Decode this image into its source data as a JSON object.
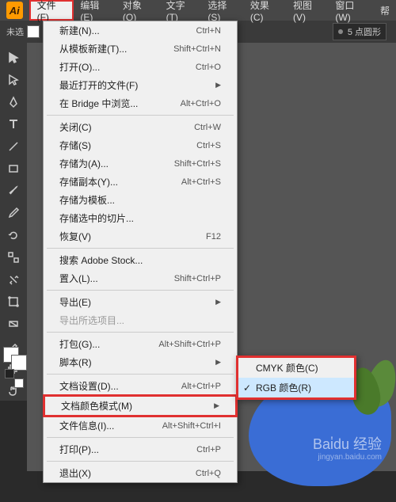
{
  "menubar": {
    "items": [
      "文件(F)",
      "编辑(E)",
      "对象(O)",
      "文字(T)",
      "选择(S)",
      "效果(C)",
      "视图(V)",
      "窗口(W)",
      "帮"
    ]
  },
  "secondbar": {
    "status": "未选",
    "prop": "5 点圆形"
  },
  "dropdown": {
    "items": [
      {
        "label": "新建(N)...",
        "shortcut": "Ctrl+N"
      },
      {
        "label": "从模板新建(T)...",
        "shortcut": "Shift+Ctrl+N"
      },
      {
        "label": "打开(O)...",
        "shortcut": "Ctrl+O"
      },
      {
        "label": "最近打开的文件(F)",
        "arrow": true
      },
      {
        "label": "在 Bridge 中浏览...",
        "shortcut": "Alt+Ctrl+O"
      },
      {
        "sep": true
      },
      {
        "label": "关闭(C)",
        "shortcut": "Ctrl+W"
      },
      {
        "label": "存储(S)",
        "shortcut": "Ctrl+S"
      },
      {
        "label": "存储为(A)...",
        "shortcut": "Shift+Ctrl+S"
      },
      {
        "label": "存储副本(Y)...",
        "shortcut": "Alt+Ctrl+S"
      },
      {
        "label": "存储为模板...",
        "shortcut": ""
      },
      {
        "label": "存储选中的切片...",
        "shortcut": ""
      },
      {
        "label": "恢复(V)",
        "shortcut": "F12"
      },
      {
        "sep": true
      },
      {
        "label": "搜索 Adobe Stock...",
        "shortcut": ""
      },
      {
        "label": "置入(L)...",
        "shortcut": "Shift+Ctrl+P"
      },
      {
        "sep": true
      },
      {
        "label": "导出(E)",
        "arrow": true
      },
      {
        "label": "导出所选项目...",
        "disabled": true
      },
      {
        "sep": true
      },
      {
        "label": "打包(G)...",
        "shortcut": "Alt+Shift+Ctrl+P"
      },
      {
        "label": "脚本(R)",
        "arrow": true
      },
      {
        "sep": true
      },
      {
        "label": "文档设置(D)...",
        "shortcut": "Alt+Ctrl+P"
      },
      {
        "label": "文档颜色模式(M)",
        "arrow": true,
        "framed": true
      },
      {
        "label": "文件信息(I)...",
        "shortcut": "Alt+Shift+Ctrl+I"
      },
      {
        "sep": true
      },
      {
        "label": "打印(P)...",
        "shortcut": "Ctrl+P"
      },
      {
        "sep": true
      },
      {
        "label": "退出(X)",
        "shortcut": "Ctrl+Q"
      }
    ]
  },
  "submenu": {
    "items": [
      {
        "label": "CMYK 颜色(C)",
        "checked": false
      },
      {
        "label": "RGB 颜色(R)",
        "checked": true,
        "selected": true
      }
    ]
  },
  "watermark": {
    "main": "Bai̇du 经验",
    "sub": "jingyan.baidu.com"
  }
}
